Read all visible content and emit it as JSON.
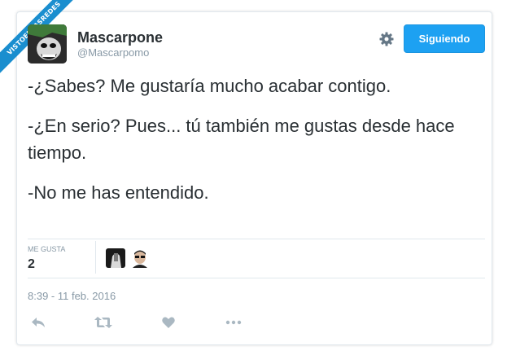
{
  "watermark": "VISTOENLASREDES",
  "user": {
    "name": "Mascarpone",
    "handle": "@Mascarpomo"
  },
  "follow_button": "Siguiendo",
  "tweet": {
    "lines": [
      "-¿Sabes? Me gustaría mucho acabar contigo.",
      "-¿En serio? Pues... tú también me gustas desde hace tiempo.",
      "-No me has entendido."
    ]
  },
  "likes": {
    "label": "ME GUSTA",
    "count": "2"
  },
  "timestamp": "8:39 - 11 feb. 2016",
  "colors": {
    "accent": "#1da1f2",
    "muted": "#8899a6",
    "text": "#292f33",
    "ribbon": "#1a8ecf"
  },
  "icons": {
    "settings": "gear-icon",
    "reply": "reply-icon",
    "retweet": "retweet-icon",
    "like": "heart-icon",
    "more": "more-icon"
  }
}
